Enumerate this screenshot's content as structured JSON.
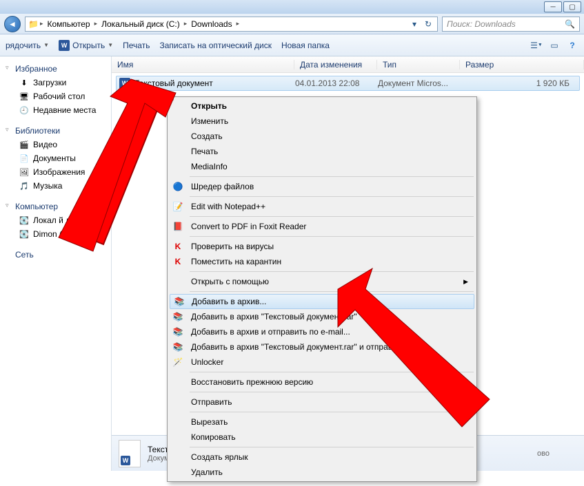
{
  "breadcrumbs": [
    "Компьютер",
    "Локальный диск (C:)",
    "Downloads"
  ],
  "search": {
    "placeholder": "Поиск: Downloads"
  },
  "toolbar": {
    "organize": "рядочить",
    "open": "Открыть",
    "print": "Печать",
    "burn": "Записать на оптический диск",
    "newfolder": "Новая папка"
  },
  "sidebar": {
    "favorites": {
      "label": "Избранное",
      "items": [
        {
          "icon": "⬇",
          "label": "Загрузки"
        },
        {
          "icon": "🖥",
          "label": "Рабочий стол"
        },
        {
          "icon": "🕘",
          "label": "Недавние места"
        }
      ]
    },
    "libraries": {
      "label": "Библиотеки",
      "items": [
        {
          "icon": "🎬",
          "label": "Видео"
        },
        {
          "icon": "📄",
          "label": "Документы"
        },
        {
          "icon": "🖼",
          "label": "Изображения"
        },
        {
          "icon": "🎵",
          "label": "Музыка"
        }
      ]
    },
    "computer": {
      "label": "Компьютер",
      "items": [
        {
          "icon": "💽",
          "label": "Локал           й диск (C:"
        },
        {
          "icon": "💽",
          "label": "Dimon (D:)"
        }
      ]
    },
    "network": {
      "label": "Сеть"
    }
  },
  "columns": {
    "name": "Имя",
    "date": "Дата изменения",
    "type": "Тип",
    "size": "Размер"
  },
  "file": {
    "name": "Текстовый документ",
    "date": "04.01.2013 22:08",
    "type": "Документ Micros...",
    "size": "1 920 КБ"
  },
  "context_menu": [
    {
      "label": "Открыть",
      "bold": true
    },
    {
      "label": "Изменить"
    },
    {
      "label": "Создать"
    },
    {
      "label": "Печать"
    },
    {
      "label": "MediaInfo"
    },
    {
      "sep": true
    },
    {
      "label": "Шредер файлов",
      "icon": "🔵"
    },
    {
      "sep": true
    },
    {
      "label": "Edit with Notepad++",
      "icon": "📝"
    },
    {
      "sep": true
    },
    {
      "label": "Convert to PDF in Foxit Reader",
      "icon": "📕"
    },
    {
      "sep": true
    },
    {
      "label": "Проверить на вирусы",
      "icon": "K",
      "iconcolor": "#d00"
    },
    {
      "label": "Поместить на карантин",
      "icon": "K",
      "iconcolor": "#d00"
    },
    {
      "sep": true
    },
    {
      "label": "Открыть с помощью",
      "arrow": true
    },
    {
      "sep": true
    },
    {
      "label": "Добавить в архив...",
      "icon": "📚",
      "hover": true
    },
    {
      "label": "Добавить в архив \"Текстовый документ.rar\"",
      "icon": "📚"
    },
    {
      "label": "Добавить в архив и отправить по e-mail...",
      "icon": "📚"
    },
    {
      "label": "Добавить в архив \"Текстовый документ.rar\" и отправить",
      "icon": "📚"
    },
    {
      "label": "Unlocker",
      "icon": "🪄"
    },
    {
      "sep": true
    },
    {
      "label": "Восстановить прежнюю версию"
    },
    {
      "sep": true
    },
    {
      "label": "Отправить",
      "arrow": true
    },
    {
      "sep": true
    },
    {
      "label": "Вырезать"
    },
    {
      "label": "Копировать"
    },
    {
      "sep": true
    },
    {
      "label": "Создать ярлык"
    },
    {
      "label": "Удалить"
    }
  ],
  "details": {
    "title": "Текстовый документ",
    "subtitle": "Документ Microsoft Word 97-2003",
    "extra": "ово"
  }
}
